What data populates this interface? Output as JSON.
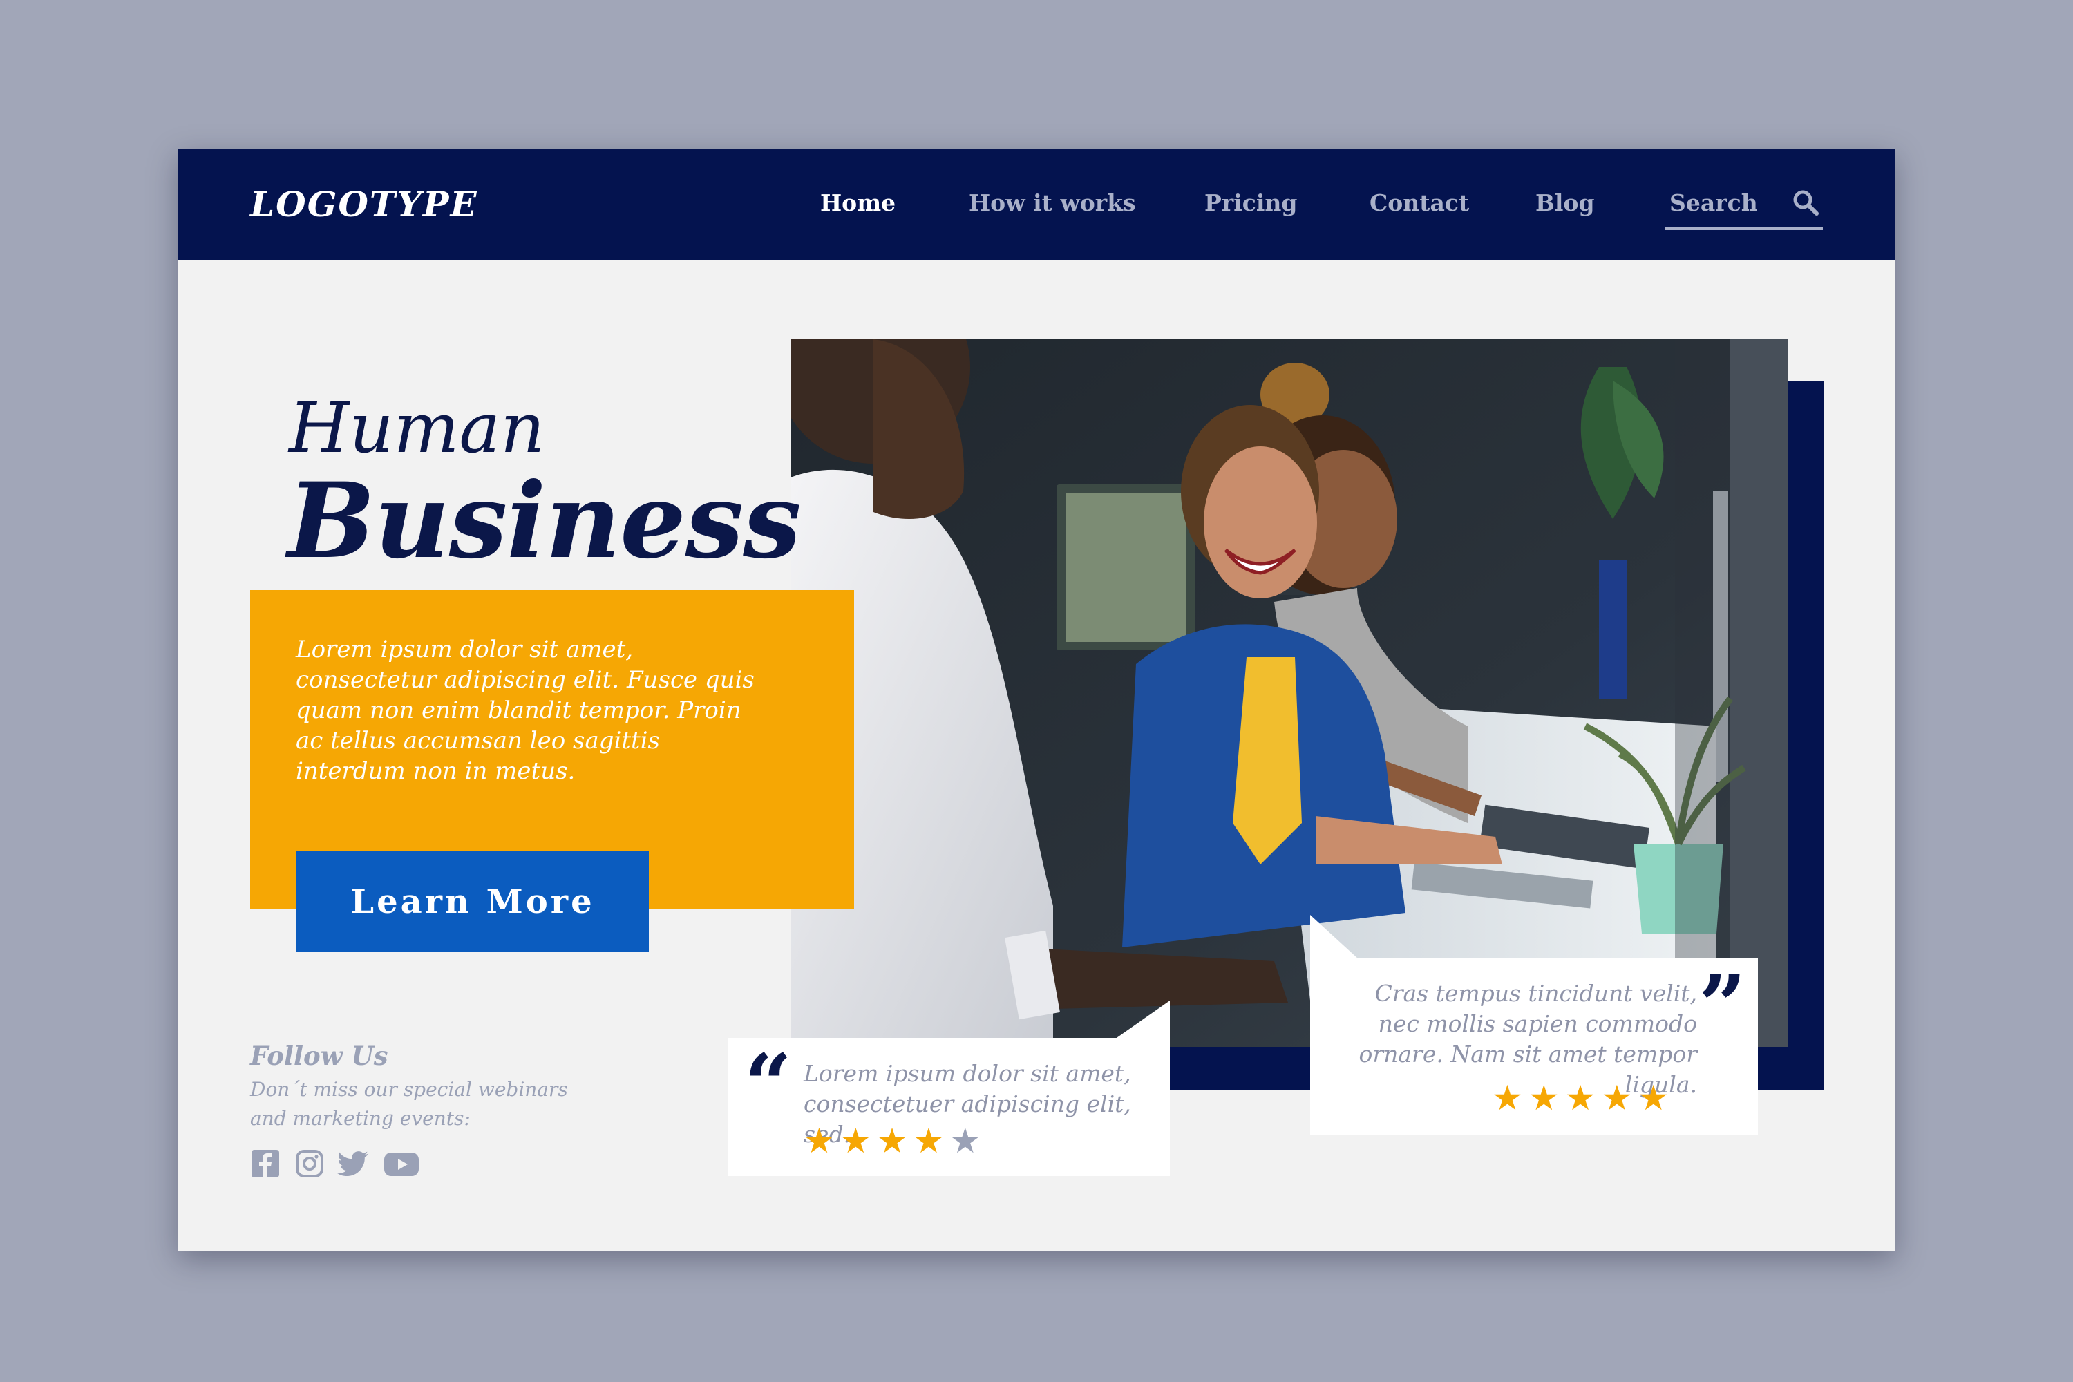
{
  "header": {
    "logo": "LOGOTYPE",
    "nav": [
      {
        "label": "Home",
        "active": true
      },
      {
        "label": "How it works",
        "active": false
      },
      {
        "label": "Pricing",
        "active": false
      },
      {
        "label": "Contact",
        "active": false
      },
      {
        "label": "Blog",
        "active": false
      }
    ],
    "search_label": "Search"
  },
  "hero": {
    "title_line1": "Human",
    "title_line2": "Business",
    "description": "Lorem ipsum dolor sit amet, consectetur adipiscing elit. Fusce quis quam non enim blandit tempor. Proin ac tellus accumsan leo sagittis interdum non in metus.",
    "cta_label": "Learn More"
  },
  "follow": {
    "title": "Follow Us",
    "description": "Don´t miss our special webinars and marketing events:",
    "icons": [
      "facebook-icon",
      "instagram-icon",
      "twitter-icon",
      "youtube-icon"
    ]
  },
  "testimonials": [
    {
      "text": "Lorem ipsum dolor sit amet, consectetuer adipiscing elit, sed.",
      "rating": 4,
      "max_rating": 5
    },
    {
      "text": "Cras tempus tincidunt velit, nec mollis sapien commodo ornare. Nam sit amet tempor ligula.",
      "rating": 5,
      "max_rating": 5
    }
  ],
  "colors": {
    "navy": "#04134f",
    "orange": "#f6a704",
    "blue": "#0b5cbf",
    "star_filled": "#f6a704",
    "star_empty": "#9aa1b6"
  }
}
